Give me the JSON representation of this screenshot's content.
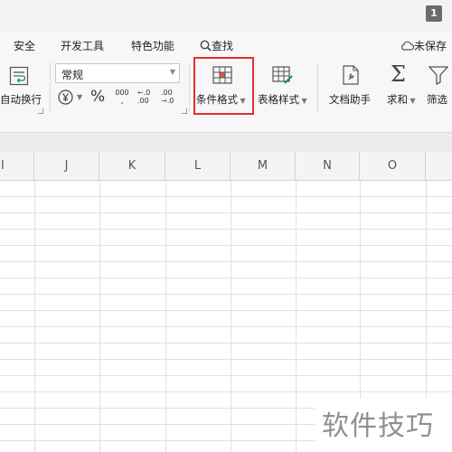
{
  "window": {
    "badge": "1"
  },
  "menu": {
    "items": [
      "安全",
      "开发工具",
      "特色功能"
    ],
    "search_label": "查找",
    "cloud_label": "未保存"
  },
  "ribbon": {
    "wrap_label": "自动换行",
    "number_format": "常规",
    "percent_symbol": "%",
    "thousands_symbol": "000",
    "dec_increase": ".0",
    "dec_decrease": ".00",
    "cond_format_label": "条件格式",
    "table_style_label": "表格样式",
    "doc_helper_label": "文档助手",
    "sum_label": "求和",
    "filter_label": "筛选",
    "highlight_color": "#e03030"
  },
  "sheet": {
    "columns": [
      "I",
      "J",
      "K",
      "L",
      "M",
      "N",
      "O"
    ]
  },
  "watermark": {
    "text": "软件技巧"
  }
}
